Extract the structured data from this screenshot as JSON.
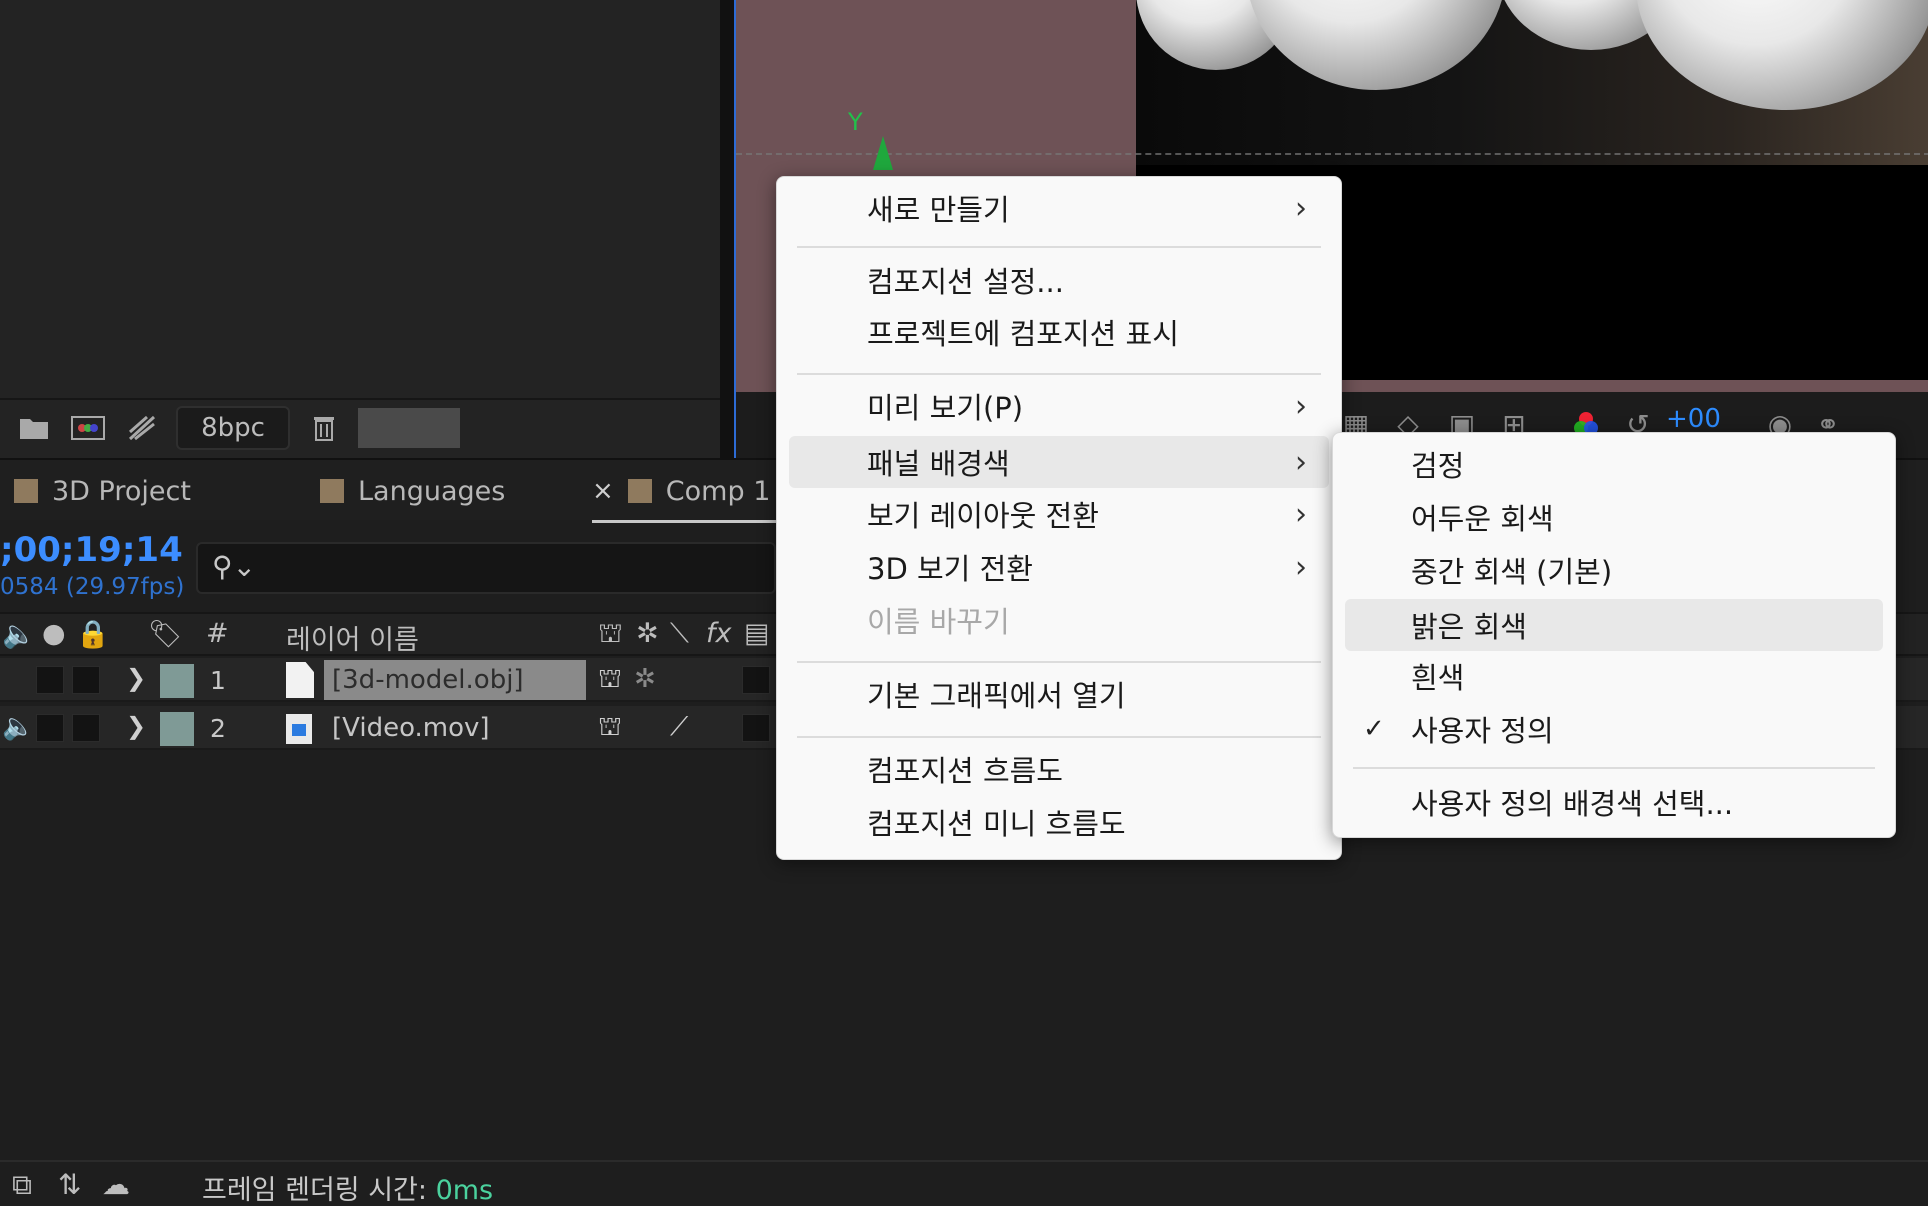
{
  "project_panel": {
    "bit_depth": "8bpc",
    "icons": [
      "folder-icon",
      "composition-icon",
      "flowchart-icon",
      "trash-icon"
    ]
  },
  "viewer": {
    "axis_label": "Y",
    "toolbar_value": "+00"
  },
  "timeline": {
    "tabs": [
      {
        "label": "3D Project"
      },
      {
        "label": "Languages"
      },
      {
        "label": "Comp 1",
        "close": "×"
      }
    ],
    "timecode": ";00;19;14",
    "frame_info": "0584 (29.97fps)",
    "columns": {
      "number": "#",
      "layer_name": "레이어 이름",
      "fx": "fx"
    },
    "layers": [
      {
        "number": "1",
        "name": "[3d-model.obj]",
        "selected": true
      },
      {
        "number": "2",
        "name": "[Video.mov]",
        "selected": false
      }
    ]
  },
  "status_bar": {
    "label": "프레임 렌더링 시간:",
    "value": "0ms"
  },
  "context_menu": {
    "items": [
      {
        "label": "새로 만들기",
        "submenu": true
      },
      {
        "label": "컴포지션 설정..."
      },
      {
        "label": "프로젝트에 컴포지션 표시"
      },
      {
        "label": "미리 보기(P)",
        "submenu": true
      },
      {
        "label": "패널 배경색",
        "submenu": true,
        "highlighted": true
      },
      {
        "label": "보기 레이아웃 전환",
        "submenu": true
      },
      {
        "label": "3D 보기 전환",
        "submenu": true
      },
      {
        "label": "이름 바꾸기",
        "disabled": true
      },
      {
        "label": "기본 그래픽에서 열기"
      },
      {
        "label": "컴포지션 흐름도"
      },
      {
        "label": "컴포지션 미니 흐름도"
      }
    ],
    "submenu_arrow": "›"
  },
  "background_submenu": {
    "items": [
      {
        "label": "검정"
      },
      {
        "label": "어두운 회색"
      },
      {
        "label": "중간 회색 (기본)"
      },
      {
        "label": "밝은 회색",
        "highlighted": true
      },
      {
        "label": "흰색"
      },
      {
        "label": "사용자 정의",
        "checked": true
      },
      {
        "label": "사용자 정의 배경색 선택..."
      }
    ],
    "check_mark": "✓"
  }
}
